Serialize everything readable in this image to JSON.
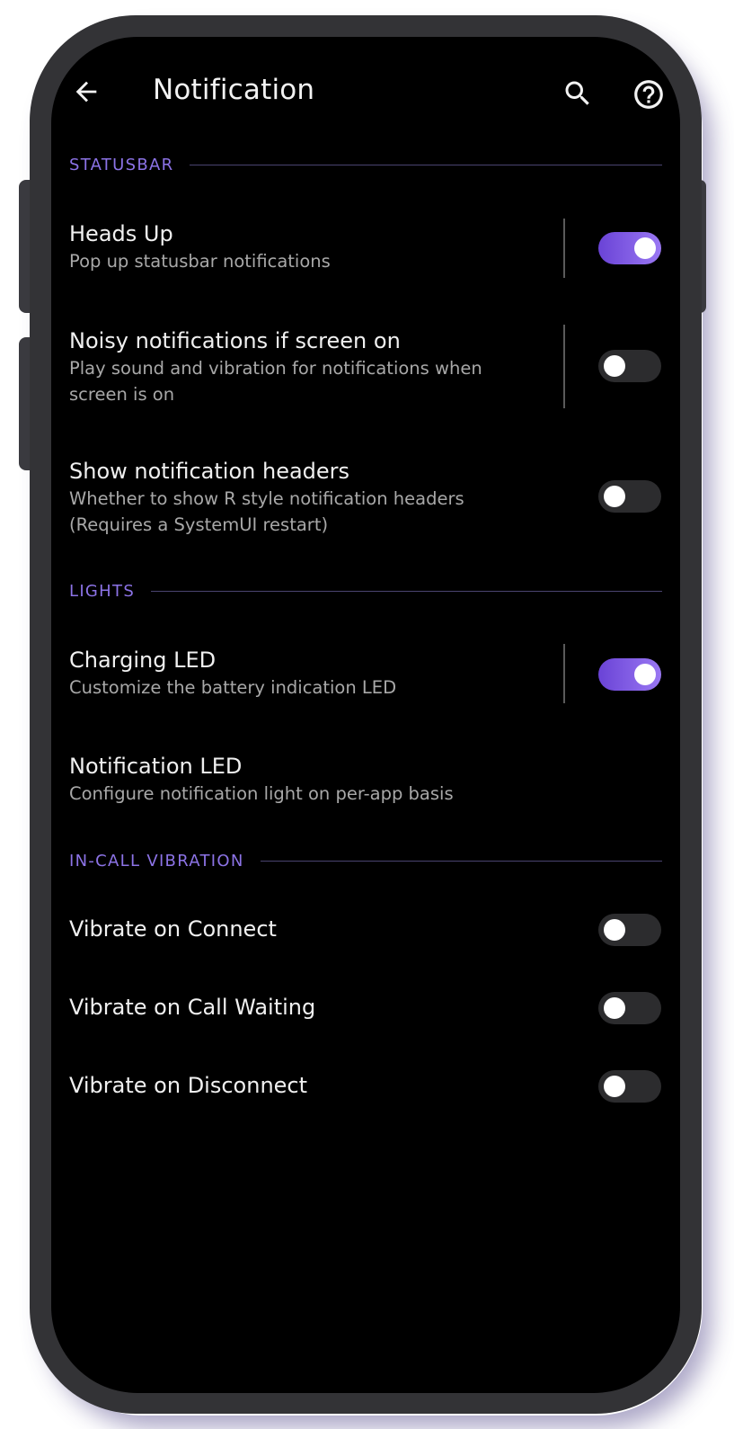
{
  "appbar": {
    "title": "Notification",
    "back_icon": "arrow-left-icon",
    "search_icon": "search-icon",
    "help_icon": "help-circle-icon"
  },
  "colors": {
    "accent": "#8c73e6",
    "toggle_on": "#7b55e8",
    "background": "#000000",
    "frame": "#333336"
  },
  "sections": {
    "statusbar": {
      "title": "STATUSBAR",
      "items": [
        {
          "title": "Heads Up",
          "summary": "Pop up statusbar notifications",
          "enabled": true
        },
        {
          "title": "Noisy notifications if screen on",
          "summary": "Play sound and vibration for notifications when screen is on",
          "enabled": false
        },
        {
          "title": "Show notification headers",
          "summary": "Whether to show R style notification headers (Requires a SystemUI restart)",
          "enabled": false
        }
      ]
    },
    "lights": {
      "title": "LIGHTS",
      "items": [
        {
          "title": "Charging LED",
          "summary": "Customize the battery indication LED",
          "enabled": true
        },
        {
          "title": "Notification LED",
          "summary": "Configure notification light on per-app basis"
        }
      ]
    },
    "in_call_vibration": {
      "title": "IN-CALL VIBRATION",
      "items": [
        {
          "title": "Vibrate on Connect",
          "enabled": false
        },
        {
          "title": "Vibrate on Call Waiting",
          "enabled": false
        },
        {
          "title": "Vibrate on Disconnect",
          "enabled": false
        }
      ]
    }
  }
}
